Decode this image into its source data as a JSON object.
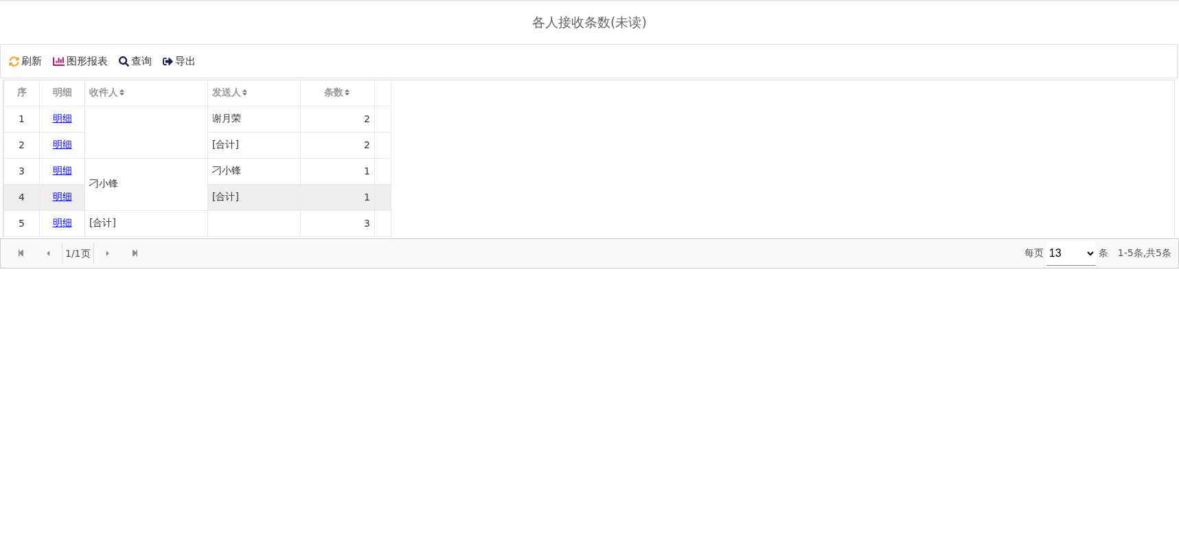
{
  "title": "各人接收条数(未读)",
  "toolbar": [
    {
      "kind": "refresh",
      "label": "刷新"
    },
    {
      "kind": "chart",
      "label": "图形报表"
    },
    {
      "kind": "search",
      "label": "查询"
    },
    {
      "kind": "export",
      "label": "导出"
    }
  ],
  "table": {
    "columns": [
      {
        "label": "序",
        "sortable": false
      },
      {
        "label": "明细",
        "sortable": false
      },
      {
        "label": "收件人",
        "sortable": true
      },
      {
        "label": "发送人",
        "sortable": true
      },
      {
        "label": "条数",
        "sortable": true
      }
    ],
    "groups": [
      {
        "rows": [
          {
            "index": "1",
            "link": "明细",
            "sender": "谢月荣",
            "count": "2",
            "selected": false
          },
          {
            "index": "2",
            "link": "明细",
            "sender": "[合计]",
            "count": "2",
            "selected": false
          }
        ]
      },
      {
        "receiver": "刁小锋",
        "rows": [
          {
            "index": "3",
            "link": "明细",
            "sender": "刁小锋",
            "count": "1",
            "selected": false
          },
          {
            "index": "4",
            "link": "明细",
            "sender": "[合计]",
            "count": "1",
            "selected": true
          }
        ]
      },
      {
        "receiver": "[合计]",
        "rows": [
          {
            "index": "5",
            "link": "明细",
            "count": "3",
            "selected": false
          }
        ]
      }
    ]
  },
  "pager": {
    "page": "1/1页",
    "per_page_label": "每页",
    "per_page": "13",
    "unit": "条",
    "summary": "1-5条,共5条"
  }
}
